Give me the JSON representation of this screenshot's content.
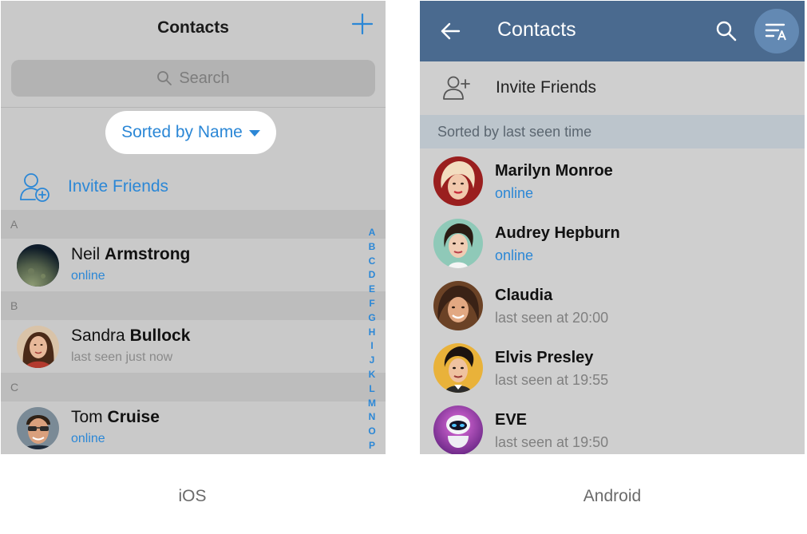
{
  "ios": {
    "caption": "iOS",
    "title": "Contacts",
    "search_placeholder": "Search",
    "sort_label": "Sorted by Name",
    "invite_label": "Invite Friends",
    "sections": [
      "A",
      "B",
      "C"
    ],
    "contacts": [
      {
        "first": "Neil",
        "last": "Armstrong",
        "status": "online",
        "online": true
      },
      {
        "first": "Sandra",
        "last": "Bullock",
        "status": "last seen just now",
        "online": false
      },
      {
        "first": "Tom",
        "last": "Cruise",
        "status": "online",
        "online": true
      }
    ],
    "index_letters": [
      "A",
      "B",
      "C",
      "D",
      "E",
      "F",
      "G",
      "H",
      "I",
      "J",
      "K",
      "L",
      "M",
      "N",
      "O",
      "P"
    ],
    "accent": "#2b87d6"
  },
  "android": {
    "caption": "Android",
    "title": "Contacts",
    "invite_label": "Invite Friends",
    "section_label": "Sorted by last seen time",
    "contacts": [
      {
        "name": "Marilyn Monroe",
        "status": "online",
        "online": true
      },
      {
        "name": "Audrey Hepburn",
        "status": "online",
        "online": true
      },
      {
        "name": "Claudia",
        "status": "last seen at 20:00",
        "online": false
      },
      {
        "name": "Elvis Presley",
        "status": "last seen at 19:55",
        "online": false
      },
      {
        "name": "EVE",
        "status": "last seen at 19:50",
        "online": false
      }
    ],
    "bar_color": "#4a6a8f",
    "accent": "#2b87d6"
  }
}
